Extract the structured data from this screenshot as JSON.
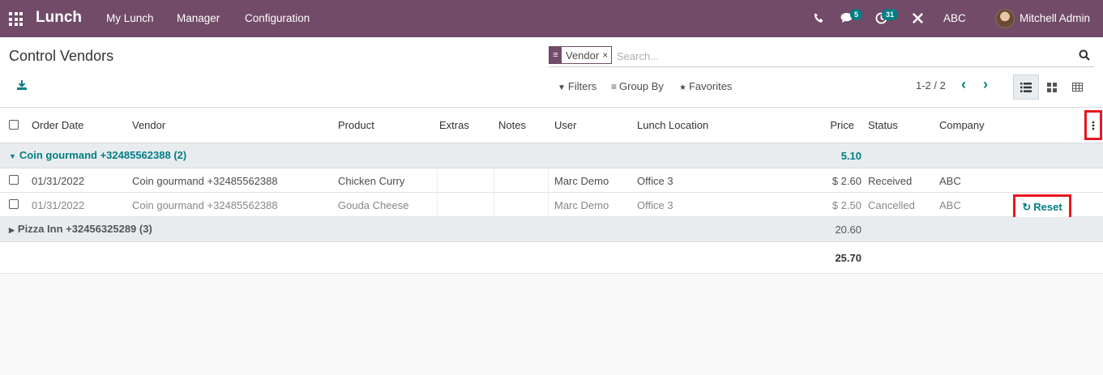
{
  "navbar": {
    "app_name": "Lunch",
    "menu": [
      "My Lunch",
      "Manager",
      "Configuration"
    ],
    "messages_badge": "5",
    "activities_badge": "31",
    "company": "ABC",
    "user": "Mitchell Admin",
    "colors": {
      "navbar": "#714b67",
      "badge": "#017e84"
    }
  },
  "control_panel": {
    "title": "Control Vendors",
    "search": {
      "facet": "Vendor",
      "facet_remove": "×",
      "placeholder": "Search..."
    },
    "filters_label": "Filters",
    "group_by_label": "Group By",
    "favorites_label": "Favorites",
    "pager": "1-2 / 2"
  },
  "table": {
    "columns": [
      "Order Date",
      "Vendor",
      "Product",
      "Extras",
      "Notes",
      "User",
      "Lunch Location",
      "Price",
      "Status",
      "Company"
    ],
    "groups": [
      {
        "label": "Coin gourmand +32485562388 (2)",
        "expanded": true,
        "total": "5.10",
        "rows": [
          {
            "date": "01/31/2022",
            "vendor": "Coin gourmand +32485562388",
            "product": "Chicken Curry",
            "extras": "",
            "notes": "",
            "user": "Marc Demo",
            "location": "Office 3",
            "price": "$ 2.60",
            "status": "Received",
            "company": "ABC",
            "action": ""
          },
          {
            "date": "01/31/2022",
            "vendor": "Coin gourmand +32485562388",
            "product": "Gouda Cheese",
            "extras": "",
            "notes": "",
            "user": "Marc Demo",
            "location": "Office 3",
            "price": "$ 2.50",
            "status": "Cancelled",
            "company": "ABC",
            "action": "Reset"
          }
        ]
      },
      {
        "label": "Pizza Inn +32456325289 (3)",
        "expanded": false,
        "total": "20.60",
        "rows": []
      }
    ],
    "grand_total": "25.70"
  },
  "icons": [
    "apps-icon",
    "phone-icon",
    "chat-icon",
    "clock-icon",
    "tools-icon",
    "download-icon",
    "search-icon",
    "filter-icon",
    "group-by-icon",
    "star-icon",
    "chevron-left-icon",
    "chevron-right-icon",
    "list-view-icon",
    "kanban-view-icon",
    "pivot-view-icon",
    "kebab-icon",
    "reset-icon"
  ]
}
